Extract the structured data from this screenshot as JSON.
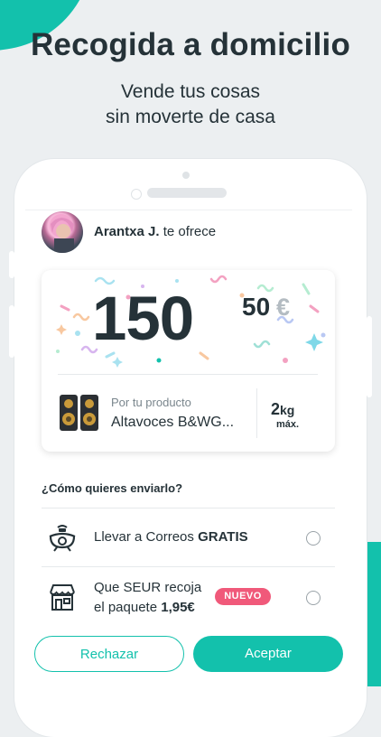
{
  "promo": {
    "headline": "Recogida a domicilio",
    "sub_line1": "Vende tus cosas",
    "sub_line2": "sin moverte de casa"
  },
  "offer": {
    "sender_name": "Arantxa J.",
    "sender_action": "te ofrece"
  },
  "price": {
    "integer": "150",
    "decimals": "50",
    "currency": "€"
  },
  "product": {
    "label": "Por tu producto",
    "name": "Altavoces B&WG...",
    "weight_value": "2",
    "weight_unit": "kg",
    "weight_note": "máx."
  },
  "shipping": {
    "question": "¿Cómo quieres enviarlo?",
    "options": [
      {
        "icon": "correos-postal-horn-icon",
        "text": "Llevar a Correos ",
        "bold": "GRATIS",
        "selected": false
      },
      {
        "icon": "seur-store-icon",
        "line1": "Que SEUR recoja",
        "line2": "el paquete ",
        "bold": "1,95€",
        "badge": "NUEVO",
        "selected": false
      }
    ]
  },
  "actions": {
    "reject": "Rechazar",
    "accept": "Aceptar"
  },
  "colors": {
    "brand": "#13C1AC",
    "badge": "#F0597A",
    "text": "#253238",
    "background": "#ECEFF1"
  }
}
